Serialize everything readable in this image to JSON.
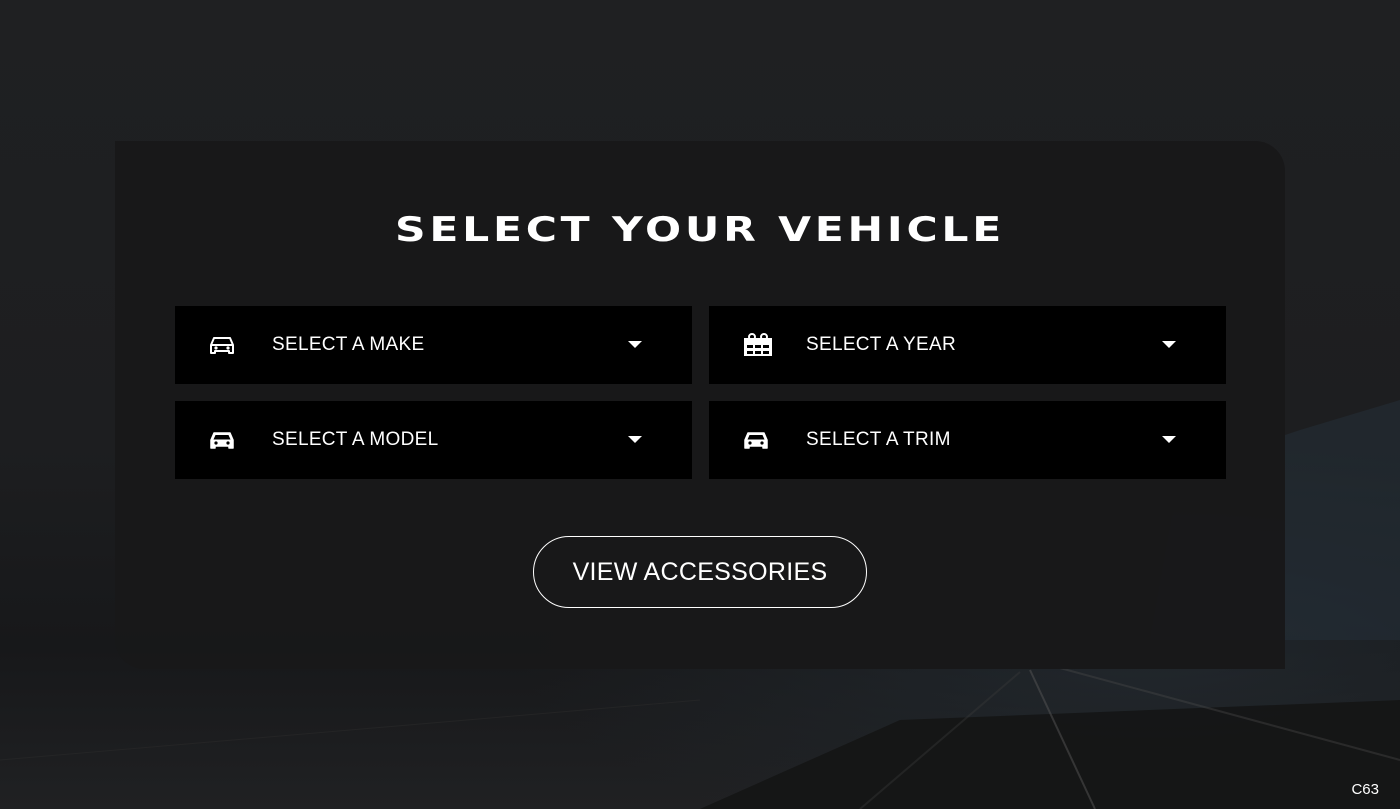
{
  "page": {
    "title": "SELECT YOUR VEHICLE",
    "footer_code": "C63"
  },
  "selects": [
    {
      "label": "SELECT A MAKE",
      "icon": "car-icon"
    },
    {
      "label": "SELECT A YEAR",
      "icon": "calendar-icon"
    },
    {
      "label": "SELECT A MODEL",
      "icon": "car-icon"
    },
    {
      "label": "SELECT A TRIM",
      "icon": "car-icon"
    }
  ],
  "actions": {
    "view_accessories_label": "VIEW ACCESSORIES"
  },
  "colors": {
    "panel": "#181819",
    "select_bg": "#000000",
    "text": "#ffffff"
  }
}
